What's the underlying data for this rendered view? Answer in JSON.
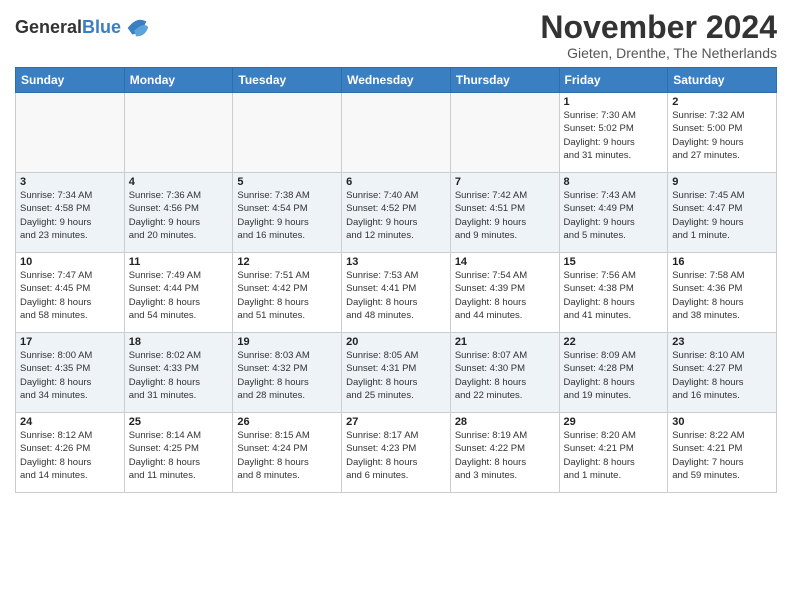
{
  "header": {
    "logo_general": "General",
    "logo_blue": "Blue",
    "month_title": "November 2024",
    "location": "Gieten, Drenthe, The Netherlands"
  },
  "calendar": {
    "days_of_week": [
      "Sunday",
      "Monday",
      "Tuesday",
      "Wednesday",
      "Thursday",
      "Friday",
      "Saturday"
    ],
    "weeks": [
      [
        {
          "day": "",
          "info": ""
        },
        {
          "day": "",
          "info": ""
        },
        {
          "day": "",
          "info": ""
        },
        {
          "day": "",
          "info": ""
        },
        {
          "day": "",
          "info": ""
        },
        {
          "day": "1",
          "info": "Sunrise: 7:30 AM\nSunset: 5:02 PM\nDaylight: 9 hours\nand 31 minutes."
        },
        {
          "day": "2",
          "info": "Sunrise: 7:32 AM\nSunset: 5:00 PM\nDaylight: 9 hours\nand 27 minutes."
        }
      ],
      [
        {
          "day": "3",
          "info": "Sunrise: 7:34 AM\nSunset: 4:58 PM\nDaylight: 9 hours\nand 23 minutes."
        },
        {
          "day": "4",
          "info": "Sunrise: 7:36 AM\nSunset: 4:56 PM\nDaylight: 9 hours\nand 20 minutes."
        },
        {
          "day": "5",
          "info": "Sunrise: 7:38 AM\nSunset: 4:54 PM\nDaylight: 9 hours\nand 16 minutes."
        },
        {
          "day": "6",
          "info": "Sunrise: 7:40 AM\nSunset: 4:52 PM\nDaylight: 9 hours\nand 12 minutes."
        },
        {
          "day": "7",
          "info": "Sunrise: 7:42 AM\nSunset: 4:51 PM\nDaylight: 9 hours\nand 9 minutes."
        },
        {
          "day": "8",
          "info": "Sunrise: 7:43 AM\nSunset: 4:49 PM\nDaylight: 9 hours\nand 5 minutes."
        },
        {
          "day": "9",
          "info": "Sunrise: 7:45 AM\nSunset: 4:47 PM\nDaylight: 9 hours\nand 1 minute."
        }
      ],
      [
        {
          "day": "10",
          "info": "Sunrise: 7:47 AM\nSunset: 4:45 PM\nDaylight: 8 hours\nand 58 minutes."
        },
        {
          "day": "11",
          "info": "Sunrise: 7:49 AM\nSunset: 4:44 PM\nDaylight: 8 hours\nand 54 minutes."
        },
        {
          "day": "12",
          "info": "Sunrise: 7:51 AM\nSunset: 4:42 PM\nDaylight: 8 hours\nand 51 minutes."
        },
        {
          "day": "13",
          "info": "Sunrise: 7:53 AM\nSunset: 4:41 PM\nDaylight: 8 hours\nand 48 minutes."
        },
        {
          "day": "14",
          "info": "Sunrise: 7:54 AM\nSunset: 4:39 PM\nDaylight: 8 hours\nand 44 minutes."
        },
        {
          "day": "15",
          "info": "Sunrise: 7:56 AM\nSunset: 4:38 PM\nDaylight: 8 hours\nand 41 minutes."
        },
        {
          "day": "16",
          "info": "Sunrise: 7:58 AM\nSunset: 4:36 PM\nDaylight: 8 hours\nand 38 minutes."
        }
      ],
      [
        {
          "day": "17",
          "info": "Sunrise: 8:00 AM\nSunset: 4:35 PM\nDaylight: 8 hours\nand 34 minutes."
        },
        {
          "day": "18",
          "info": "Sunrise: 8:02 AM\nSunset: 4:33 PM\nDaylight: 8 hours\nand 31 minutes."
        },
        {
          "day": "19",
          "info": "Sunrise: 8:03 AM\nSunset: 4:32 PM\nDaylight: 8 hours\nand 28 minutes."
        },
        {
          "day": "20",
          "info": "Sunrise: 8:05 AM\nSunset: 4:31 PM\nDaylight: 8 hours\nand 25 minutes."
        },
        {
          "day": "21",
          "info": "Sunrise: 8:07 AM\nSunset: 4:30 PM\nDaylight: 8 hours\nand 22 minutes."
        },
        {
          "day": "22",
          "info": "Sunrise: 8:09 AM\nSunset: 4:28 PM\nDaylight: 8 hours\nand 19 minutes."
        },
        {
          "day": "23",
          "info": "Sunrise: 8:10 AM\nSunset: 4:27 PM\nDaylight: 8 hours\nand 16 minutes."
        }
      ],
      [
        {
          "day": "24",
          "info": "Sunrise: 8:12 AM\nSunset: 4:26 PM\nDaylight: 8 hours\nand 14 minutes."
        },
        {
          "day": "25",
          "info": "Sunrise: 8:14 AM\nSunset: 4:25 PM\nDaylight: 8 hours\nand 11 minutes."
        },
        {
          "day": "26",
          "info": "Sunrise: 8:15 AM\nSunset: 4:24 PM\nDaylight: 8 hours\nand 8 minutes."
        },
        {
          "day": "27",
          "info": "Sunrise: 8:17 AM\nSunset: 4:23 PM\nDaylight: 8 hours\nand 6 minutes."
        },
        {
          "day": "28",
          "info": "Sunrise: 8:19 AM\nSunset: 4:22 PM\nDaylight: 8 hours\nand 3 minutes."
        },
        {
          "day": "29",
          "info": "Sunrise: 8:20 AM\nSunset: 4:21 PM\nDaylight: 8 hours\nand 1 minute."
        },
        {
          "day": "30",
          "info": "Sunrise: 8:22 AM\nSunset: 4:21 PM\nDaylight: 7 hours\nand 59 minutes."
        }
      ]
    ]
  }
}
